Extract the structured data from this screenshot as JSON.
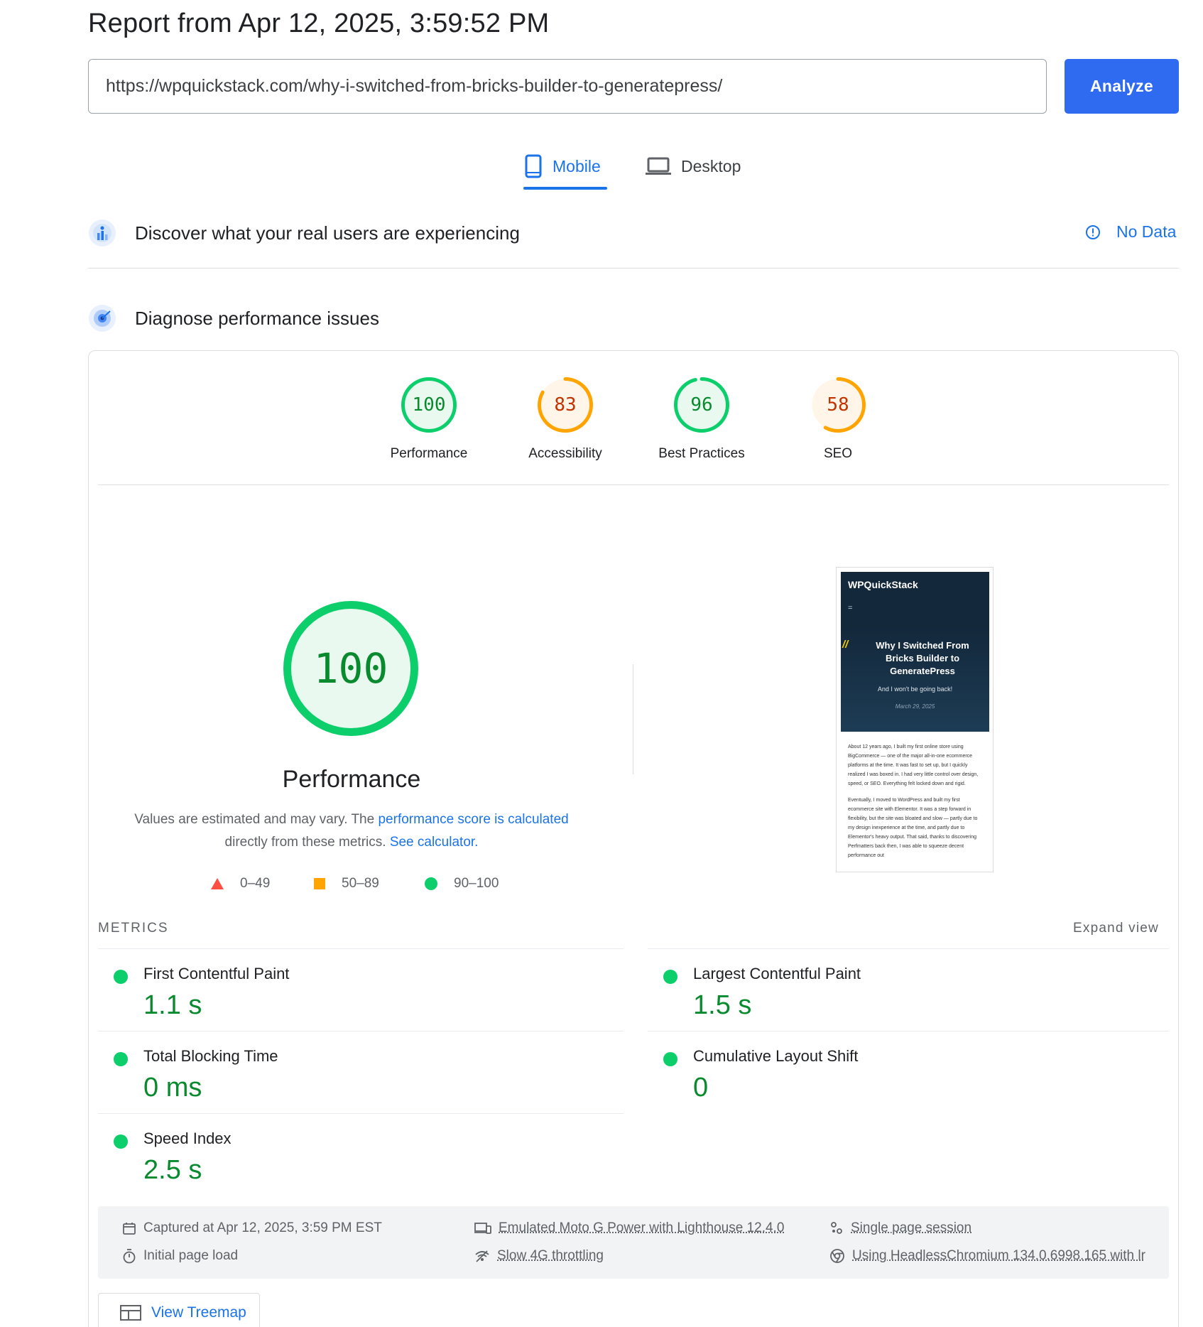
{
  "header": {
    "title": "Report from Apr 12, 2025, 3:59:52 PM",
    "url_value": "https://wpquickstack.com/why-i-switched-from-bricks-builder-to-generatepress/",
    "analyze_label": "Analyze"
  },
  "tabs": [
    {
      "label": "Mobile",
      "active": true
    },
    {
      "label": "Desktop",
      "active": false
    }
  ],
  "field_data": {
    "title": "Discover what your real users are experiencing",
    "no_data_label": "No Data"
  },
  "lab": {
    "title": "Diagnose performance issues",
    "scores": [
      {
        "label": "Performance",
        "score": "100",
        "value": 100,
        "color": "#0cce6b",
        "text_color": "#0a8a2f"
      },
      {
        "label": "Accessibility",
        "score": "83",
        "value": 83,
        "color": "#ffa400",
        "text_color": "#c33300"
      },
      {
        "label": "Best Practices",
        "score": "96",
        "value": 96,
        "color": "#0cce6b",
        "text_color": "#0a8a2f"
      },
      {
        "label": "SEO",
        "score": "58",
        "value": 58,
        "color": "#ffa400",
        "text_color": "#c33300"
      }
    ],
    "big": {
      "score": "100",
      "value": 100,
      "title": "Performance",
      "text_before": "Values are estimated and may vary. The ",
      "link1": "performance score is calculated",
      "text_middle": " directly from these metrics. ",
      "link2": "See calculator."
    },
    "legend": [
      "0–49",
      "50–89",
      "90–100"
    ]
  },
  "thumbnail": {
    "brand": "WPQuickStack",
    "menu": "=",
    "quote": "//",
    "headline": "Why I Switched From Bricks Builder to GeneratePress",
    "subtitle": "And I won't be going back!",
    "date": "March 29, 2025",
    "para1": "About 12 years ago, I built my first online store using BigCommerce — one of the major all-in-one ecommerce platforms at the time. It was fast to set up, but I quickly realized I was boxed in. I had very little control over design, speed, or SEO. Everything felt locked down and rigid.",
    "para2": "Eventually, I moved to WordPress and built my first ecommerce site with Elementor. It was a step forward in flexibility, but the site was bloated and slow — partly due to my design inexperience at the time, and partly due to Elementor's heavy output. That said, thanks to discovering Perfmatters back then, I was able to squeeze decent performance out"
  },
  "metrics": {
    "heading": "METRICS",
    "expand_label": "Expand view",
    "items": [
      {
        "label": "First Contentful Paint",
        "value": "1.1 s"
      },
      {
        "label": "Largest Contentful Paint",
        "value": "1.5 s"
      },
      {
        "label": "Total Blocking Time",
        "value": "0 ms"
      },
      {
        "label": "Cumulative Layout Shift",
        "value": "0"
      },
      {
        "label": "Speed Index",
        "value": "2.5 s"
      }
    ]
  },
  "runtime": {
    "captured": "Captured at Apr 12, 2025, 3:59 PM EST",
    "initial_load": "Initial page load",
    "device": "Emulated Moto G Power with Lighthouse 12.4.0",
    "throttling": "Slow 4G throttling",
    "session": "Single page session",
    "browser": "Using HeadlessChromium 134.0.6998.165 with lr"
  },
  "treemap_label": "View Treemap",
  "colors": {
    "accent": "#1a73e8",
    "pass": "#0cce6b",
    "average": "#ffa400",
    "fail": "#ff4e42"
  }
}
